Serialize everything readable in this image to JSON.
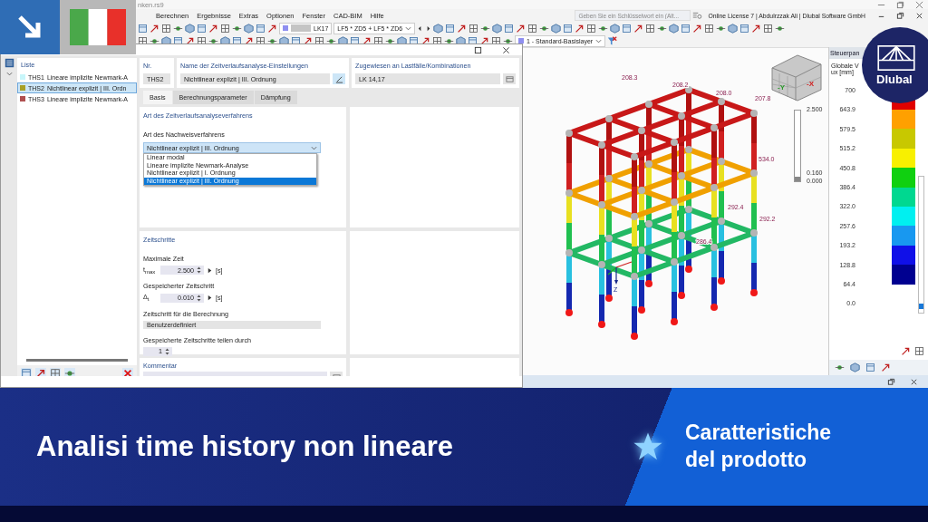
{
  "app": {
    "title": "nken.rs9",
    "menu": [
      "Berechnen",
      "Ergebnisse",
      "Extras",
      "Optionen",
      "Fenster",
      "CAD-BIM",
      "Hilfe"
    ],
    "search": {
      "placeholder": "Geben Sie ein Schlüsselwort ein (Alt..."
    },
    "license": "Online License 7 | Abdulrzzak Ali | Dlubal Software GmbH",
    "load_case": "LK17",
    "combination": "LF5 * ZD5 + LF5 * ZD6",
    "layer": "1 - Standard-Basislayer"
  },
  "viewport": {
    "cube_labels": [
      "-Y",
      "-X"
    ],
    "axis_label": "Z",
    "time_slider": {
      "max": "2.500",
      "current": "0.160",
      "min": "0.000",
      "level": 0.064
    },
    "labels": [
      {
        "text": "208.3"
      },
      {
        "text": "208.2"
      },
      {
        "text": "208.0"
      },
      {
        "text": "207.8"
      },
      {
        "text": "534.0"
      },
      {
        "text": "292.4"
      },
      {
        "text": "292.2"
      },
      {
        "text": "286.4"
      }
    ]
  },
  "panel": {
    "title": "Steuerpan",
    "heading": "Globale V",
    "unit": "ux [mm]",
    "legend": [
      {
        "value": "700"
      },
      {
        "value": "643.9",
        "color": "#e00000"
      },
      {
        "value": "579.5",
        "color": "#ffa000"
      },
      {
        "value": "515.2",
        "color": "#c8c800"
      },
      {
        "value": "450.8",
        "color": "#f8f000"
      },
      {
        "value": "386.4",
        "color": "#10d010"
      },
      {
        "value": "322.0",
        "color": "#00d890"
      },
      {
        "value": "257.6",
        "color": "#00f0f0"
      },
      {
        "value": "193.2",
        "color": "#1898f0"
      },
      {
        "value": "128.8",
        "color": "#1010e8"
      },
      {
        "value": "64.4",
        "color": "#000090"
      },
      {
        "value": "0.0"
      }
    ]
  },
  "dialog": {
    "list": {
      "title": "Liste",
      "items": [
        {
          "id": "THS1",
          "name": "Lineare implizite Newmark-A",
          "color": "#c8f6fa",
          "selected": false
        },
        {
          "id": "THS2",
          "name": "Nichtlinear explizit | III. Ordn",
          "color": "#a8a028",
          "selected": true
        },
        {
          "id": "THS3",
          "name": "Lineare implizite Newmark-A",
          "color": "#b05050",
          "selected": false
        }
      ]
    },
    "nr": {
      "label": "Nr.",
      "value": "THS2"
    },
    "name": {
      "label": "Name der Zeitverlaufsanalyse-Einstellungen",
      "value": "Nichtlinear explizit | III. Ordnung"
    },
    "assigned": {
      "label": "Zugewiesen an Lastfälle/Kombinationen",
      "value": "LK 14,17"
    },
    "tabs": [
      {
        "label": "Basis",
        "selected": true
      },
      {
        "label": "Berechnungsparameter",
        "selected": false
      },
      {
        "label": "Dämpfung",
        "selected": false
      }
    ],
    "method": {
      "section": "Art des Zeitverlaufsanalyseverfahrens",
      "label": "Art des Nachweisverfahrens",
      "value": "Nichtlinear explizit | III. Ordnung",
      "options": [
        {
          "label": "Linear modal",
          "selected": false
        },
        {
          "label": "Lineare implizite Newmark-Analyse",
          "selected": false
        },
        {
          "label": "Nichtlinear explizit | I. Ordnung",
          "selected": false
        },
        {
          "label": "Nichtlinear explizit | III. Ordnung",
          "selected": true
        }
      ]
    },
    "time_steps": {
      "section": "Zeitschritte",
      "fields": [
        {
          "kind": "spinner",
          "label": "Maximale Zeit",
          "symbol": "t$_{max}$",
          "value": "2.500",
          "unit": "[s]"
        },
        {
          "kind": "spinner",
          "label": "Gespeicherter Zeitschritt",
          "symbol": "Δ$_{t}$",
          "value": "0.010",
          "unit": "[s]"
        },
        {
          "kind": "readonly",
          "label": "Zeitschritt für die Berechnung",
          "value": "Benutzerdefiniert"
        },
        {
          "kind": "counter",
          "label": "Gespeicherte Zeitschritte teilen durch",
          "value": "1"
        }
      ]
    },
    "comment": {
      "section": "Kommentar"
    }
  },
  "logo": {
    "text": "Dlubal"
  },
  "banner": {
    "title": "Analisi time history non lineare",
    "tag": "Caratteristiche del prodotto"
  }
}
